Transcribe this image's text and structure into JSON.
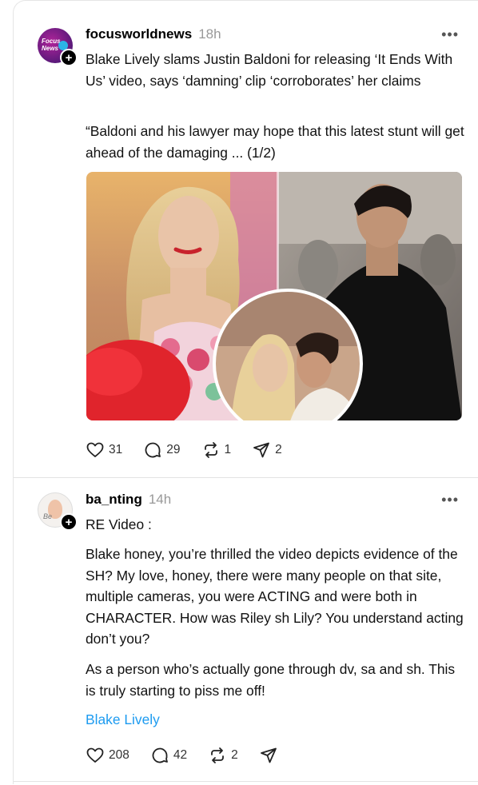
{
  "posts": [
    {
      "username": "focusworldnews",
      "time": "18h",
      "avatar_text": "Focus News",
      "headline": "Blake Lively slams Justin Baldoni for releasing ‘It Ends With Us’ video, says ‘damning’ clip ‘corroborates’ her claims",
      "body": "“Baldoni and his lawyer may hope that this latest stunt will get ahead of the damaging ... (1/2)",
      "stats": {
        "likes": "31",
        "replies": "29",
        "reposts": "1",
        "shares": "2"
      }
    },
    {
      "username": "ba_nting",
      "time": "14h",
      "avatar_text": "Be",
      "line1": "RE Video :",
      "para1": "Blake honey, you’re thrilled the video depicts evidence of the SH? My love, honey, there were many people on that site, multiple cameras, you were ACTING and were both in CHARACTER. How was Riley sh Lily? You understand acting don’t you?",
      "para2": "As a person who’s actually gone through dv, sa and sh. This is truly starting to piss me off!",
      "tag": "Blake Lively",
      "stats": {
        "likes": "208",
        "replies": "42",
        "reposts": "2",
        "shares": ""
      }
    }
  ],
  "icons": {
    "heart": "heart-icon",
    "reply": "comment-icon",
    "repost": "repost-icon",
    "share": "share-icon",
    "more": "more-icon",
    "follow": "plus-icon"
  },
  "colors": {
    "link": "#1d9bf0",
    "muted": "#999999",
    "divider": "#e3e3e3"
  }
}
